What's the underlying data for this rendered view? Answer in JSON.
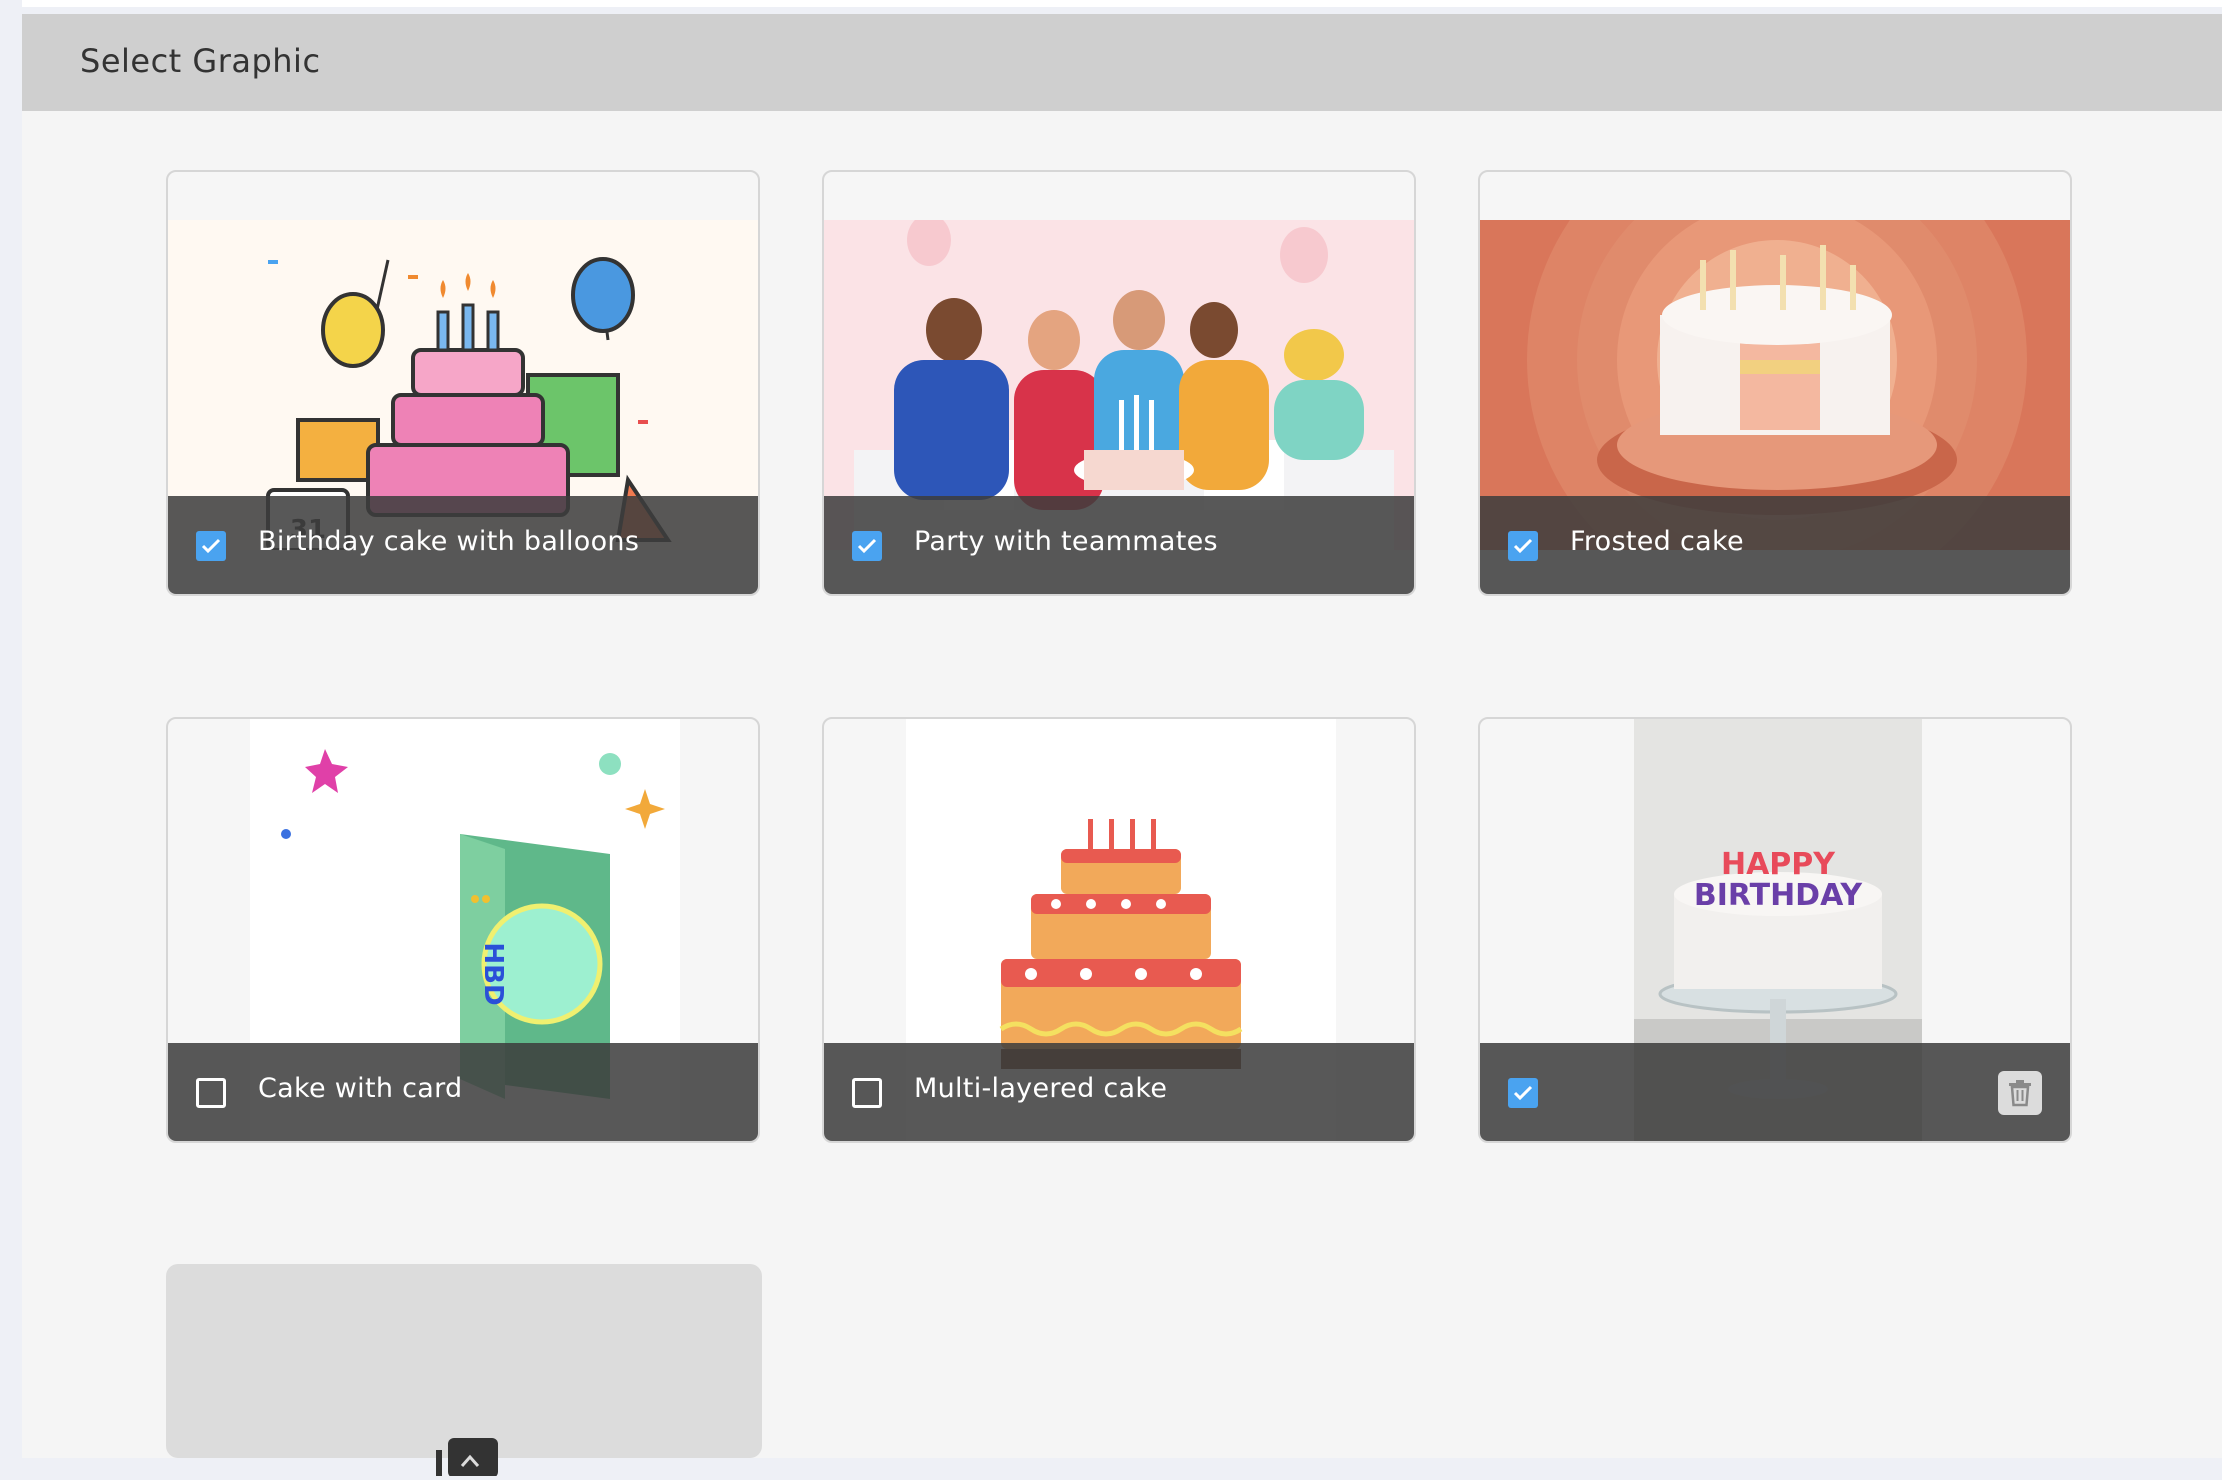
{
  "panel": {
    "title": "Select Graphic"
  },
  "graphics": [
    {
      "label": "Birthday cake with balloons",
      "checked": true
    },
    {
      "label": "Party with teammates",
      "checked": true
    },
    {
      "label": "Frosted cake",
      "checked": true
    },
    {
      "label": "Cake with card",
      "checked": false
    },
    {
      "label": "Multi-layered cake",
      "checked": false
    },
    {
      "label": "",
      "checked": true,
      "image_text_top": "HAPPY",
      "image_text_bottom": "BIRTHDAY",
      "deletable": true
    }
  ],
  "card_image_text": {
    "card_code": "HBD",
    "calendar_day": "31"
  },
  "colors": {
    "accent": "#4aa3f0",
    "header": "#cfcfcf",
    "panel": "#f5f5f5",
    "label_bar": "#4a4a4a"
  },
  "icons": {
    "check": "check-icon",
    "delete": "trash-icon",
    "upload": "image-upload-icon"
  }
}
